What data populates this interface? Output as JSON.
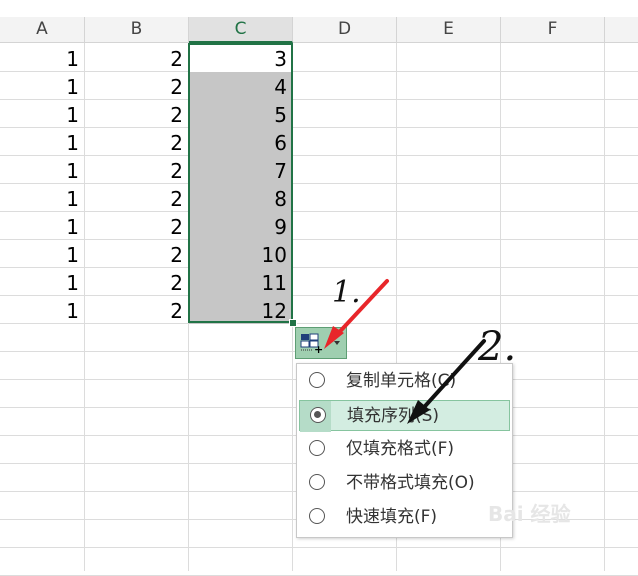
{
  "columns": [
    "A",
    "B",
    "C",
    "D",
    "E",
    "F"
  ],
  "active_column": "C",
  "rows": [
    [
      "1",
      "2",
      "3"
    ],
    [
      "1",
      "2",
      "4"
    ],
    [
      "1",
      "2",
      "5"
    ],
    [
      "1",
      "2",
      "6"
    ],
    [
      "1",
      "2",
      "7"
    ],
    [
      "1",
      "2",
      "8"
    ],
    [
      "1",
      "2",
      "9"
    ],
    [
      "1",
      "2",
      "10"
    ],
    [
      "1",
      "2",
      "11"
    ],
    [
      "1",
      "2",
      "12"
    ]
  ],
  "autofill_menu": {
    "items": [
      {
        "label": "复制单元格(C)",
        "checked": false
      },
      {
        "label": "填充序列(S)",
        "checked": true
      },
      {
        "label": "仅填充格式(F)",
        "checked": false
      },
      {
        "label": "不带格式填充(O)",
        "checked": false
      },
      {
        "label": "快速填充(F)",
        "checked": false
      }
    ]
  },
  "annotations": {
    "step1": "1.",
    "step2": "2.",
    "arrow1_color": "#e8262a",
    "arrow2_color": "#111111"
  },
  "colors": {
    "accent": "#217346",
    "selection_fill": "#c6c6c6",
    "menu_highlight": "#d3ede1"
  },
  "watermark": "Bai 经验"
}
